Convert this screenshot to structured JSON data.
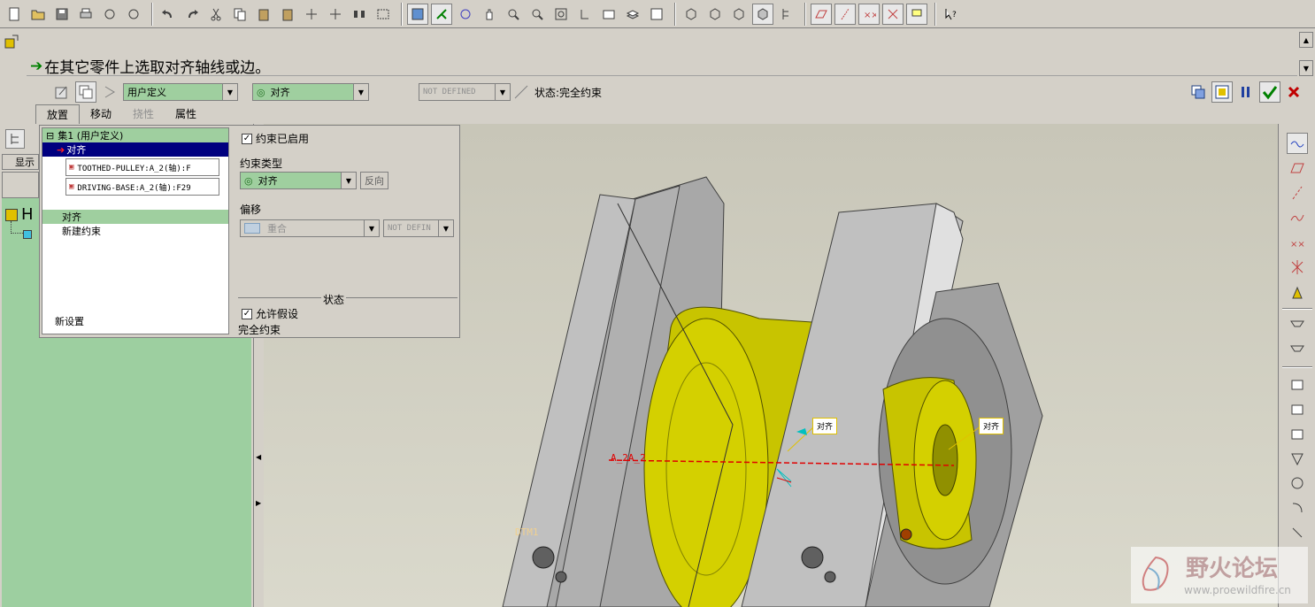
{
  "prompt": {
    "message": "在其它零件上选取对齐轴线或边。"
  },
  "dashboard": {
    "set_type": "用户定义",
    "constraint_type": "对齐",
    "offset_value": "NOT DEFINED",
    "status_label": "状态:完全约束",
    "tabs": [
      "放置",
      "移动",
      "挠性",
      "属性"
    ]
  },
  "placement": {
    "set_header": "集1 (用户定义)",
    "constraint_selected": "对齐",
    "refs": [
      "TOOTHED-PULLEY:A_2(轴):F",
      "DRIVING-BASE:A_2(轴):F29"
    ],
    "constraint_item": "对齐",
    "new_constraint": "新建约束",
    "new_set": "新设置",
    "enabled_label": "约束已启用",
    "type_label": "约束类型",
    "type_value": "对齐",
    "flip_button": "反向",
    "offset_label": "偏移",
    "offset_type": "重合",
    "offset_value": "NOT DEFIN",
    "status_heading": "状态",
    "allow_assume": "允许假设",
    "status_text": "完全约束"
  },
  "left_panel": {
    "tab_display": "显示",
    "tree_root": "H"
  },
  "viewport": {
    "axis_label": "A_2A_2",
    "datum_label": "DTM1",
    "callout_1": "对齐",
    "callout_2": "对齐"
  },
  "watermark": {
    "name": "野火论坛",
    "url": "www.proewildfire.cn"
  },
  "colors": {
    "part_yellow": "#c8c400",
    "part_gray": "#b8b8b8",
    "tree_green": "#9dcfa0",
    "selection": "#00007f"
  }
}
